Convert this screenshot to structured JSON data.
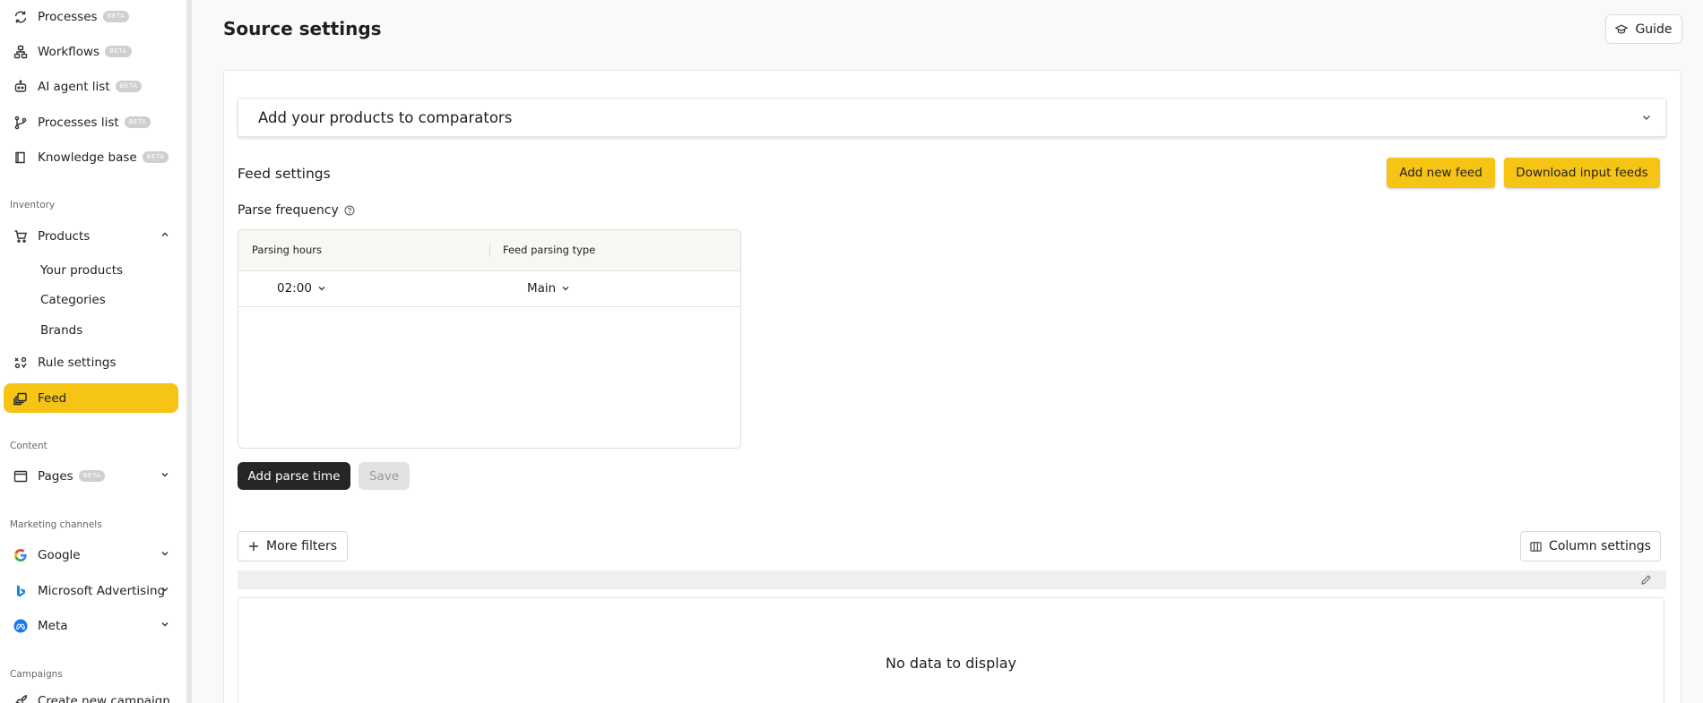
{
  "sidebar": {
    "items": [
      {
        "label": "Processes",
        "badge": "BETA",
        "icon": "refresh-icon"
      },
      {
        "label": "Workflows",
        "badge": "BETA",
        "icon": "workflow-icon"
      },
      {
        "label": "AI agent list",
        "badge": "BETA",
        "icon": "robot-icon"
      },
      {
        "label": "Processes list",
        "badge": "BETA",
        "icon": "branch-icon"
      },
      {
        "label": "Knowledge base",
        "badge": "BETA",
        "icon": "book-icon"
      }
    ],
    "sections": {
      "inventory": "Inventory",
      "content": "Content",
      "marketing": "Marketing channels",
      "campaigns": "Campaigns"
    },
    "products": {
      "label": "Products",
      "icon": "cart-icon",
      "sub": [
        "Your products",
        "Categories",
        "Brands"
      ]
    },
    "rule_settings": {
      "label": "Rule settings",
      "icon": "rule-icon"
    },
    "feed": {
      "label": "Feed",
      "icon": "feed-icon"
    },
    "pages": {
      "label": "Pages",
      "badge": "BETA",
      "icon": "window-icon"
    },
    "google": {
      "label": "Google",
      "icon": "google-icon"
    },
    "microsoft": {
      "label": "Microsoft Advertising",
      "icon": "bing-icon"
    },
    "meta": {
      "label": "Meta",
      "icon": "meta-icon"
    },
    "create_campaign": {
      "label": "Create new campaign",
      "icon": "rocket-icon"
    },
    "active_color": "#f6c414"
  },
  "header": {
    "title": "Source settings",
    "guide_label": "Guide"
  },
  "accordion": {
    "title": "Add your products to comparators"
  },
  "feed_settings": {
    "title": "Feed settings",
    "add_new_feed": "Add new feed",
    "download_input_feeds": "Download input feeds",
    "parse_frequency": "Parse frequency",
    "table": {
      "columns": [
        "Parsing hours",
        "Feed parsing type"
      ],
      "rows": [
        {
          "hour": "02:00",
          "type": "Main"
        }
      ]
    },
    "add_parse_time": "Add parse time",
    "save": "Save"
  },
  "grid": {
    "more_filters": "More filters",
    "column_settings": "Column settings",
    "empty_message": "No data to display"
  }
}
